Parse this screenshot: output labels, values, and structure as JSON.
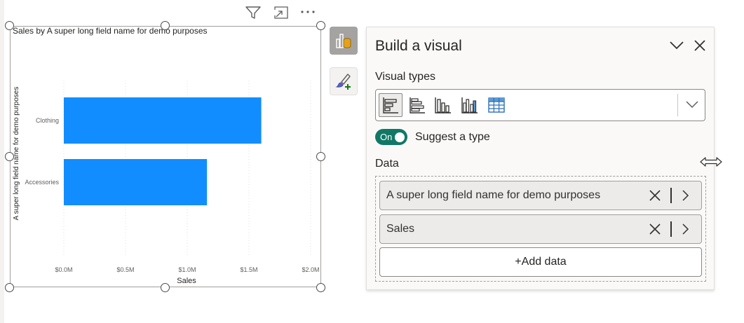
{
  "visual": {
    "header_icons": [
      "filter-icon",
      "focus-mode-icon",
      "more-options-icon"
    ]
  },
  "chart_data": {
    "type": "bar",
    "orientation": "horizontal",
    "title": "Sales by A super long field name for demo purposes",
    "xlabel": "Sales",
    "ylabel": "A super long field name for demo purposes",
    "categories": [
      "Clothing",
      "Accessories"
    ],
    "values": [
      1.6,
      1.16
    ],
    "value_unit": "$M",
    "xlim": [
      0,
      2.0
    ],
    "xticks": [
      "$0.0M",
      "$0.5M",
      "$1.0M",
      "$1.5M",
      "$2.0M"
    ],
    "bar_color": "#118DFF",
    "grid": "vertical dotted",
    "legend": "none"
  },
  "rail": {
    "build_visual_icon": "build-visual-icon",
    "format_visual_icon": "format-paintbrush-icon"
  },
  "pane": {
    "title": "Build a visual",
    "visual_types_label": "Visual types",
    "visual_types": [
      "stacked-bar-chart-icon",
      "clustered-bar-chart-icon",
      "stacked-column-chart-icon",
      "clustered-column-chart-icon",
      "table-icon"
    ],
    "toggle_label": "On",
    "suggest_label": "Suggest a type",
    "data_label": "Data",
    "fields": [
      "A super long field name for demo purposes",
      "Sales"
    ],
    "add_data_label": "+Add data"
  },
  "colors": {
    "accent_bar": "#118DFF",
    "toggle_on": "#117865",
    "build_visual_orange": "#E3A21A",
    "format_green": "#107C10"
  }
}
